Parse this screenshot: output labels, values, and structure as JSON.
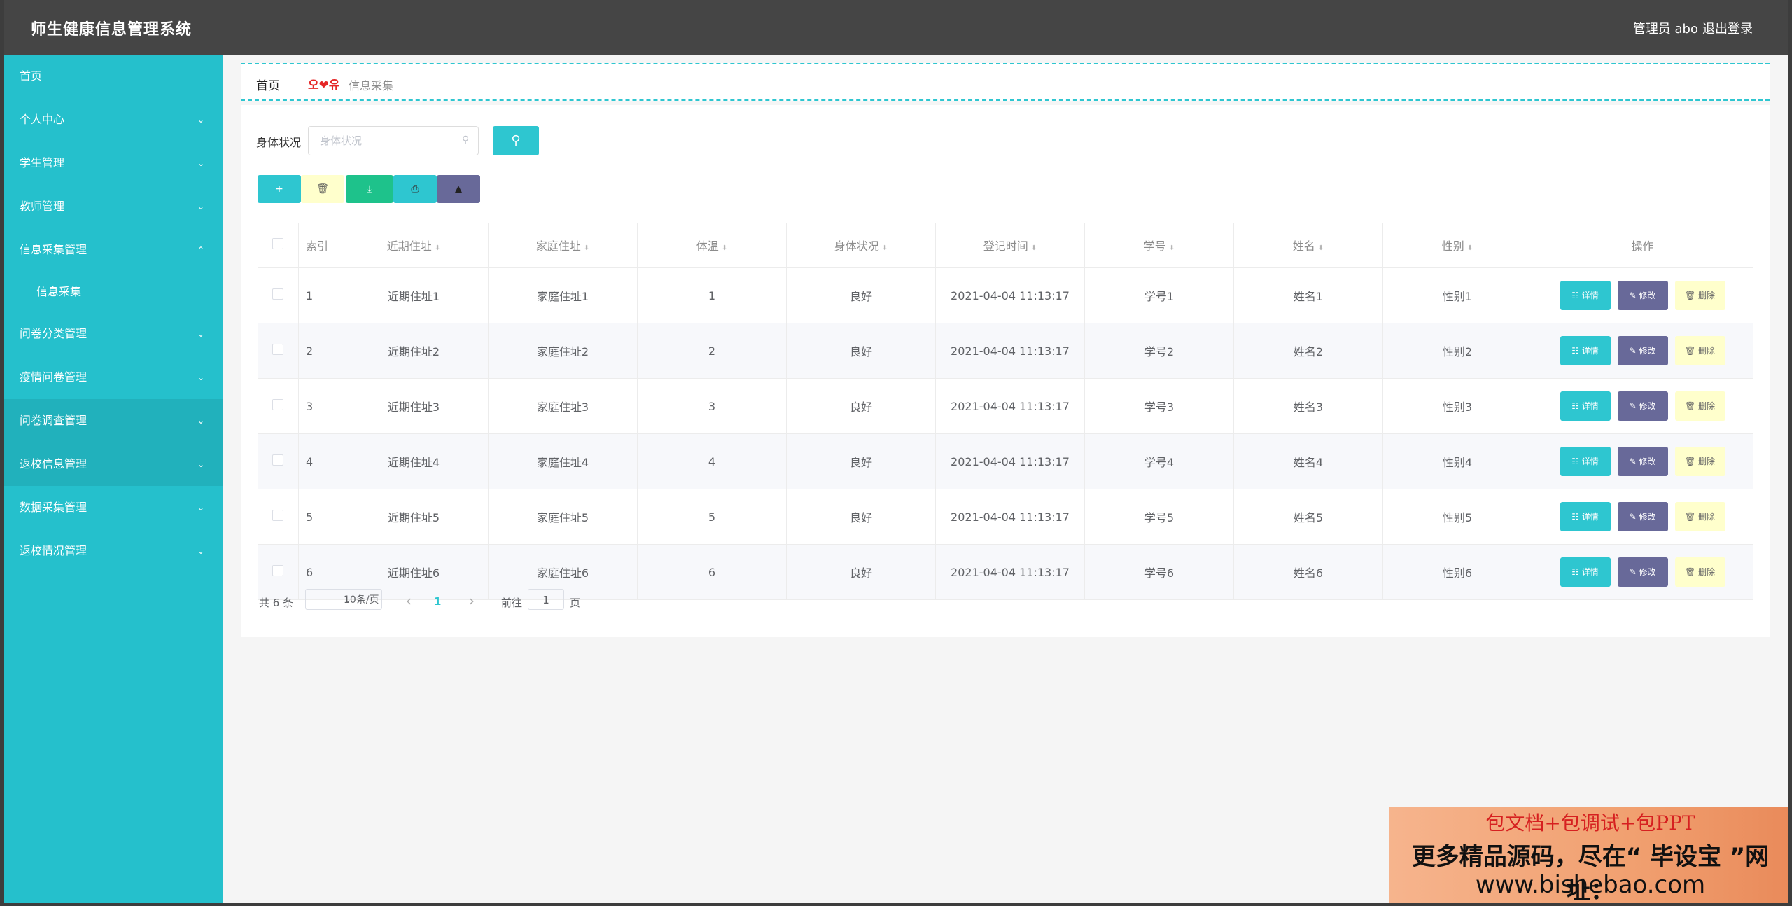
{
  "app": {
    "title": "师生健康信息管理系统",
    "user": "管理员 abo",
    "logout": "退出登录"
  },
  "sidebar": [
    {
      "label": "首页",
      "chevron": ""
    },
    {
      "label": "个人中心",
      "chevron": "⌄"
    },
    {
      "label": "学生管理",
      "chevron": "⌄"
    },
    {
      "label": "教师管理",
      "chevron": "⌄"
    },
    {
      "label": "信息采集管理",
      "chevron": "⌃"
    },
    {
      "label": "信息采集",
      "chevron": ""
    },
    {
      "label": "问卷分类管理",
      "chevron": "⌄"
    },
    {
      "label": "疫情问卷管理",
      "chevron": "⌄"
    },
    {
      "label": "问卷调查管理",
      "chevron": "⌄"
    },
    {
      "label": "返校信息管理",
      "chevron": "⌄"
    },
    {
      "label": "数据采集管理",
      "chevron": "⌄"
    },
    {
      "label": "返校情况管理",
      "chevron": "⌄"
    }
  ],
  "breadcrumb": {
    "home": "首页",
    "sep": "오❤유",
    "current": "信息采集"
  },
  "search": {
    "label": "身体状况",
    "placeholder": "身体状况",
    "icon": "search-icon"
  },
  "toolbar": {
    "add": "+",
    "delete": "🗑",
    "download": "⤓",
    "print": "⎙",
    "stats": "▲"
  },
  "table": {
    "headers": [
      "索引",
      "近期住址",
      "家庭住址",
      "体温",
      "身体状况",
      "登记时间",
      "学号",
      "姓名",
      "性别",
      "操作"
    ],
    "rows": [
      [
        "1",
        "近期住址1",
        "家庭住址1",
        "1",
        "良好",
        "2021-04-04 11:13:17",
        "学号1",
        "姓名1",
        "性别1"
      ],
      [
        "2",
        "近期住址2",
        "家庭住址2",
        "2",
        "良好",
        "2021-04-04 11:13:17",
        "学号2",
        "姓名2",
        "性别2"
      ],
      [
        "3",
        "近期住址3",
        "家庭住址3",
        "3",
        "良好",
        "2021-04-04 11:13:17",
        "学号3",
        "姓名3",
        "性别3"
      ],
      [
        "4",
        "近期住址4",
        "家庭住址4",
        "4",
        "良好",
        "2021-04-04 11:13:17",
        "学号4",
        "姓名4",
        "性别4"
      ],
      [
        "5",
        "近期住址5",
        "家庭住址5",
        "5",
        "良好",
        "2021-04-04 11:13:17",
        "学号5",
        "姓名5",
        "性别5"
      ],
      [
        "6",
        "近期住址6",
        "家庭住址6",
        "6",
        "良好",
        "2021-04-04 11:13:17",
        "学号6",
        "姓名6",
        "性别6"
      ]
    ],
    "actions": {
      "detail": "☷ 详情",
      "edit": "✎ 修改",
      "delete": "🗑 删除"
    }
  },
  "pager": {
    "total": "共 6 条",
    "size": "10条/页",
    "prev": "‹",
    "page": "1",
    "next": "›",
    "goto_prefix": "前往",
    "goto_value": "1",
    "goto_suffix": "页"
  },
  "watermark": {
    "line1": "包文档+包调试+包PPT",
    "line2": "更多精品源码，尽在“ 毕设宝 ”网址：",
    "line3": "www.bishebao.com"
  },
  "colors": {
    "sidebar": "#25c0cc",
    "primary": "#2ec6d0",
    "edit": "#686999",
    "delete": "#ffffcc",
    "download": "#1ec28b"
  }
}
